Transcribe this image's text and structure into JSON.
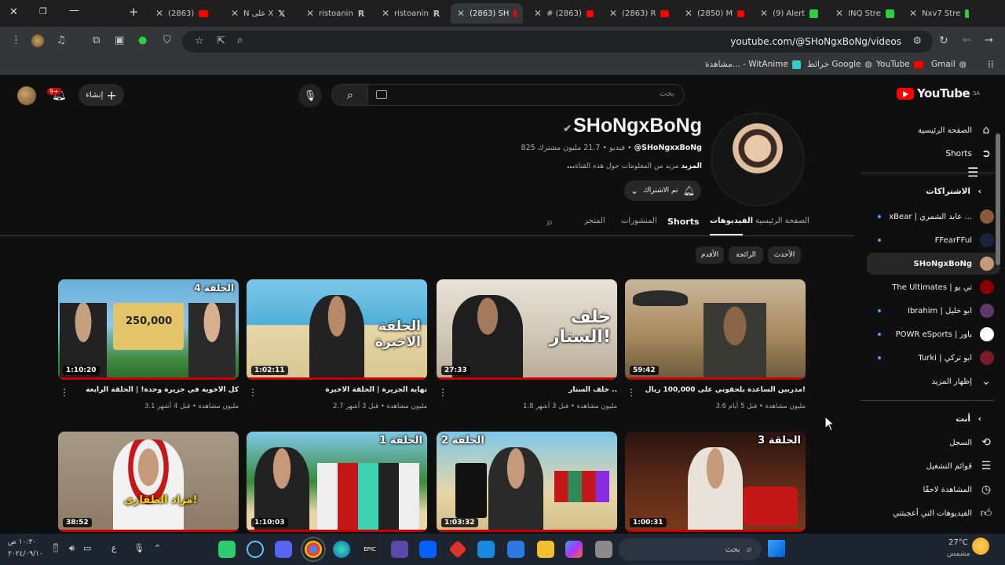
{
  "browser": {
    "tabs": [
      {
        "title": "(2863) ",
        "icon": "youtube-favicon"
      },
      {
        "title": "N على X",
        "icon": "x-favicon"
      },
      {
        "title": "ristoanin",
        "icon": "r-favicon"
      },
      {
        "title": "ristoanin",
        "icon": "r-favicon"
      },
      {
        "title": "(2863) SH",
        "icon": "youtube-favicon"
      },
      {
        "title": "# (2863)",
        "icon": "youtube-favicon"
      },
      {
        "title": "(2863) R",
        "icon": "youtube-favicon"
      },
      {
        "title": "(2850) M",
        "icon": "youtube-favicon"
      },
      {
        "title": "(9) Alert",
        "icon": "kick-favicon"
      },
      {
        "title": "INQ Stre",
        "icon": "kick-favicon"
      },
      {
        "title": "Nxv7 Stre",
        "icon": "kick-favicon"
      }
    ],
    "url": "youtube.com/@SHoNgxBoNg/videos",
    "bookmarks": [
      {
        "label": "Gmail"
      },
      {
        "label": "YouTube"
      },
      {
        "label": "خرائط Google"
      },
      {
        "label": "مشاهدة... - WitAnime"
      }
    ]
  },
  "masthead": {
    "search_placeholder": "بحث",
    "create_label": "إنشاء",
    "notif_count": "9+",
    "logo_text": "YouTube",
    "region": "SA"
  },
  "sidebar": {
    "home": "الصفحة الرئيسية",
    "shorts": "Shorts",
    "subscriptions_heading": "الاشتراكات",
    "channels": [
      {
        "name": "xBear | عابد الشمري ...",
        "dot": true
      },
      {
        "name": "FFearFFul",
        "dot": true
      },
      {
        "name": "SHoNgxBoNg",
        "dot": false
      },
      {
        "name": "The Ultimates | تي يو",
        "dot": false
      },
      {
        "name": "Ibrahim | ابو خليل",
        "dot": true
      },
      {
        "name": "POWR eSports | باور",
        "dot": true
      },
      {
        "name": "Turki | ابو تركي",
        "dot": true
      }
    ],
    "show_more": "إظهار المزيد",
    "you_heading": "أنت",
    "you_items": [
      {
        "label": "السجل",
        "icon": "history-icon"
      },
      {
        "label": "قوائم التشغيل",
        "icon": "playlists-icon"
      },
      {
        "label": "المشاهدة لاحقًا",
        "icon": "watch-later-icon"
      },
      {
        "label": "الفيديوهات التي أعجبتني",
        "icon": "like-icon"
      }
    ]
  },
  "channel": {
    "name": "SHoNgxBoNg",
    "handle": "@SHoNgxxBoNg",
    "subscribers": "21.7 مليون مشترك",
    "videos_count": "825 فيديو",
    "about": "مزيد من المعلومات حول هذه القناة",
    "about_more": "...المزيد",
    "subscribed_label": "تم الاشتراك",
    "tabs": [
      "الصفحة الرئيسية",
      "الفيديوهات",
      "Shorts",
      "المنشورات",
      "المتجر"
    ],
    "active_tab": "الفيديوهات",
    "chips": [
      "الأحدث",
      "الرائجة",
      "الأقدم"
    ]
  },
  "videos": [
    {
      "title": "مدربين الساعدة بلحقوني على 100,000 ريال!",
      "meta": "3.6 مليون مشاهدة • قبل 5 أيام",
      "duration": "59:42",
      "overlay": ""
    },
    {
      "title": "خلف الستار ..",
      "meta": "1.8 مليون مشاهدة • قبل 3 أشهر",
      "duration": "27:33",
      "overlay": "خلف الستار!"
    },
    {
      "title": "نهاية الجزيرة | الحلقة الاخيرة",
      "meta": "2.7 مليون مشاهدة • قبل 3 أشهر",
      "duration": "1:02:11",
      "overlay": "الحلقة الاخيرة"
    },
    {
      "title": "كل الأخوية في جزيرة وحدة! | الحلقة الرابعة",
      "meta": "3.1 مليون مشاهدة • قبل 4 أشهر",
      "duration": "1:10:20",
      "overlay": "الحلقة 4",
      "overlay2": "250,000"
    },
    {
      "title": "",
      "meta": "",
      "duration": "1:00:31",
      "overlay": "الحلقة 3"
    },
    {
      "title": "",
      "meta": "",
      "duration": "1:03:32",
      "overlay": "الحلقة 2"
    },
    {
      "title": "",
      "meta": "",
      "duration": "1:10:03",
      "overlay": "الحلقة 1"
    },
    {
      "title": "",
      "meta": "",
      "duration": "38:52",
      "overlay": "مزاد الطقاري!"
    }
  ],
  "taskbar": {
    "search_placeholder": "بحث",
    "weather_temp": "27°C",
    "weather_desc": "مشمس",
    "time": "١٠:٣٠ ص",
    "date": "٢٠٢٤/٠٩/١٠",
    "lang": "ع"
  },
  "colors": {
    "accent_red": "#ff0000",
    "background": "#0f0f0f",
    "surface": "#272727",
    "link_blue": "#3ea6ff"
  }
}
